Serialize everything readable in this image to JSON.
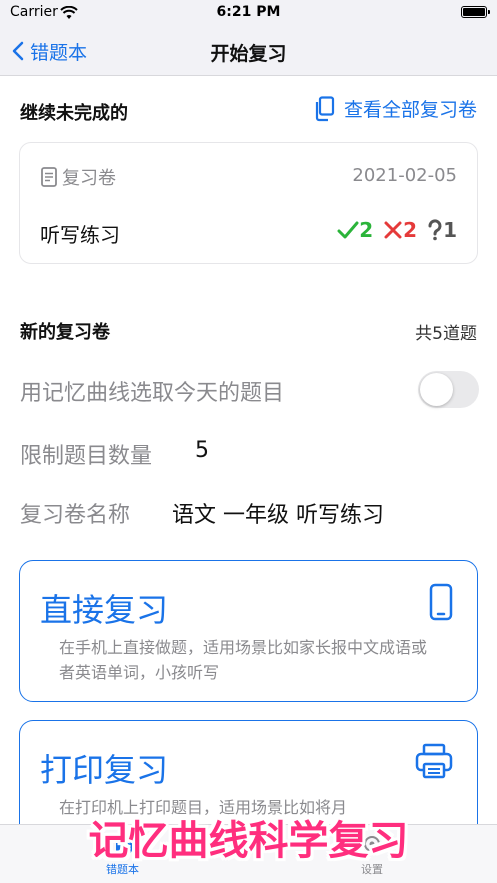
{
  "status_bar": {
    "carrier": "Carrier",
    "time": "6:21 PM",
    "battery_level": 1.0
  },
  "nav": {
    "back_label": "错题本",
    "title": "开始复习"
  },
  "unfinished": {
    "header": "继续未完成的",
    "view_all_label": "查看全部复习卷",
    "card": {
      "type_label": "复习卷",
      "date": "2021-02-05",
      "name": "听写练习",
      "correct_count": "2",
      "wrong_count": "2",
      "unknown_count": "1"
    }
  },
  "new_paper": {
    "header": "新的复习卷",
    "count_label": "共5道题",
    "memory_curve_label": "用记忆曲线选取今天的题目",
    "memory_curve_enabled": false,
    "limit_label": "限制题目数量",
    "limit_value": "5",
    "name_label": "复习卷名称",
    "name_value": "语文 一年级 听写练习"
  },
  "options": [
    {
      "title": "直接复习",
      "description": "在手机上直接做题，适用场景比如家长报中文成语或者英语单词，小孩听写",
      "icon": "phone-icon"
    },
    {
      "title": "打印复习",
      "description": "在打印机上打印题目，适用场景比如将月",
      "icon": "printer-icon"
    }
  ],
  "tab_bar": {
    "tabs": [
      {
        "label": "错题本",
        "active": true
      },
      {
        "label": "设置",
        "active": false
      }
    ]
  },
  "overlay_caption": "记忆曲线科学复习",
  "colors": {
    "accent": "#1a73e8",
    "correct": "#2bb43a",
    "wrong": "#e53a3a",
    "caption": "#ff2e7e"
  }
}
